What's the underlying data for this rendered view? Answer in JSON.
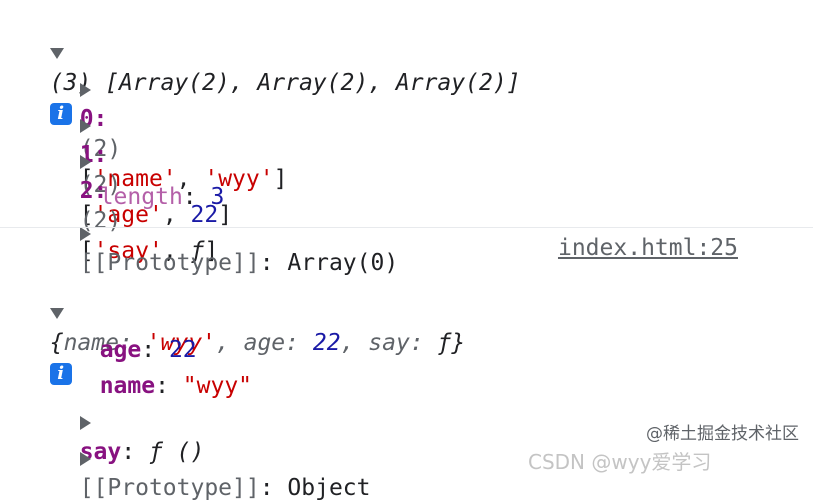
{
  "array_log": {
    "summary": "(3) [Array(2), Array(2), Array(2)]",
    "items": [
      {
        "index": "0:",
        "count": "(2)",
        "open": "[",
        "first": "'name'",
        "sep": ", ",
        "second": "'wyy'",
        "close": "]"
      },
      {
        "index": "1:",
        "count": "(2)",
        "open": "[",
        "first": "'age'",
        "sep": ", ",
        "second": "22",
        "close": "]"
      },
      {
        "index": "2:",
        "count": "(2)",
        "open": "[",
        "first": "'say'",
        "sep": ", ",
        "second": "ƒ",
        "close": "]"
      }
    ],
    "length_key": "length",
    "length_value": "3",
    "prototype_key": "[[Prototype]]",
    "prototype_value": "Array(0)"
  },
  "source_link": "index.html:25",
  "object_log": {
    "summary_open": "{",
    "name_key": "name",
    "name_val": "'wyy'",
    "age_key": "age",
    "age_val": "22",
    "say_key": "say",
    "say_val": "ƒ",
    "summary_close": "}",
    "props": {
      "age_key": "age",
      "age_value": "22",
      "name_key": "name",
      "name_value": "\"wyy\"",
      "say_key": "say",
      "say_value": "ƒ ()",
      "prototype_key": "[[Prototype]]",
      "prototype_value": "Object"
    }
  },
  "info_icon_label": "i",
  "watermark": "@稀土掘金技术社区",
  "partial_watermark": "CSDN @wyy爱学习"
}
